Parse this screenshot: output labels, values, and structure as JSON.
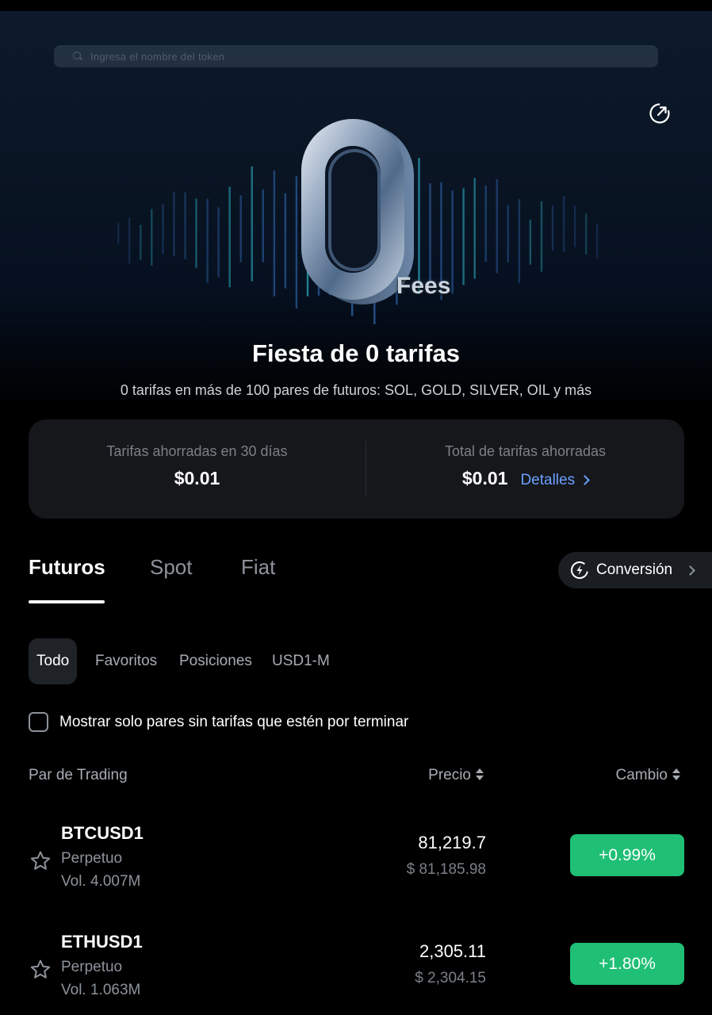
{
  "search": {
    "placeholder": "Ingresa el nombre del token"
  },
  "banner": {
    "badge_text": "Fees",
    "title": "Fiesta de 0 tarifas",
    "subtitle": "0 tarifas en más de 100 pares de futuros: SOL, GOLD, SILVER, OIL y más"
  },
  "savings": {
    "last30_label": "Tarifas ahorradas en 30 días",
    "last30_value": "$0.01",
    "total_label": "Total de tarifas ahorradas",
    "total_value": "$0.01",
    "details_label": "Detalles"
  },
  "tabs": [
    {
      "label": "Futuros",
      "active": true
    },
    {
      "label": "Spot",
      "active": false
    },
    {
      "label": "Fiat",
      "active": false
    }
  ],
  "conversion_label": "Conversión",
  "filters": [
    {
      "label": "Todo",
      "active": true
    },
    {
      "label": "Favoritos",
      "active": false
    },
    {
      "label": "Posiciones",
      "active": false
    },
    {
      "label": "USD1-M",
      "active": false
    }
  ],
  "expiring_checkbox_label": "Mostrar solo pares sin tarifas que estén por terminar",
  "table": {
    "col_pair": "Par de Trading",
    "col_price": "Precio",
    "col_change": "Cambio",
    "rows": [
      {
        "symbol": "BTCUSD1",
        "type": "Perpetuo",
        "volume": "Vol. 4.007M",
        "price": "81,219.7",
        "fiat_price": "$ 81,185.98",
        "change": "+0.99%"
      },
      {
        "symbol": "ETHUSD1",
        "type": "Perpetuo",
        "volume": "Vol. 1.063M",
        "price": "2,305.11",
        "fiat_price": "$ 2,304.15",
        "change": "+1.80%"
      }
    ]
  },
  "colors": {
    "background": "#000000",
    "card": "#15171b",
    "link": "#6aa0ff",
    "positive": "#1fbf75",
    "muted": "#8d939b"
  }
}
